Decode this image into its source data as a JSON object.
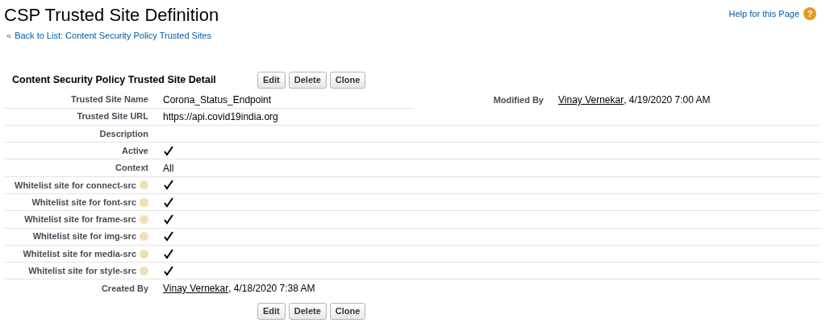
{
  "title": "CSP Trusted Site Definition",
  "back_link": {
    "prefix": "«",
    "text": "Back to List: Content Security Policy Trusted Sites"
  },
  "help_link": "Help for this Page",
  "help_icon": "?",
  "section_title": "Content Security Policy Trusted Site Detail",
  "buttons": [
    "Edit",
    "Delete",
    "Clone"
  ],
  "top_row": {
    "label": "Trusted Site Name",
    "value": "Corona_Status_Endpoint",
    "right_label": "Modified By",
    "right_user": "Vinay Vernekar",
    "right_date": ", 4/19/2020 7:00 AM"
  },
  "fields": [
    {
      "kind": "text",
      "label": "Trusted Site URL",
      "value": "https://api.covid19india.org"
    },
    {
      "kind": "text",
      "label": "Description"
    },
    {
      "kind": "checkbox",
      "label": "Active",
      "checked": true
    },
    {
      "kind": "text",
      "label": "Context",
      "value": "All"
    },
    {
      "kind": "help_checkbox",
      "label": "Whitelist site for connect-src",
      "checked": true
    },
    {
      "kind": "help_checkbox",
      "label": "Whitelist site for font-src",
      "checked": true
    },
    {
      "kind": "help_checkbox",
      "label": "Whitelist site for frame-src",
      "checked": true
    },
    {
      "kind": "help_checkbox",
      "label": "Whitelist site for img-src",
      "checked": true
    },
    {
      "kind": "help_checkbox",
      "label": "Whitelist site for media-src",
      "checked": true
    },
    {
      "kind": "help_checkbox",
      "label": "Whitelist site for style-src",
      "checked": true
    },
    {
      "kind": "user",
      "label": "Created By",
      "user": "Vinay Vernekar",
      "date": ", 4/18/2020 7:38 AM"
    }
  ],
  "bottom_buttons": [
    "Edit",
    "Delete",
    "Clone"
  ]
}
